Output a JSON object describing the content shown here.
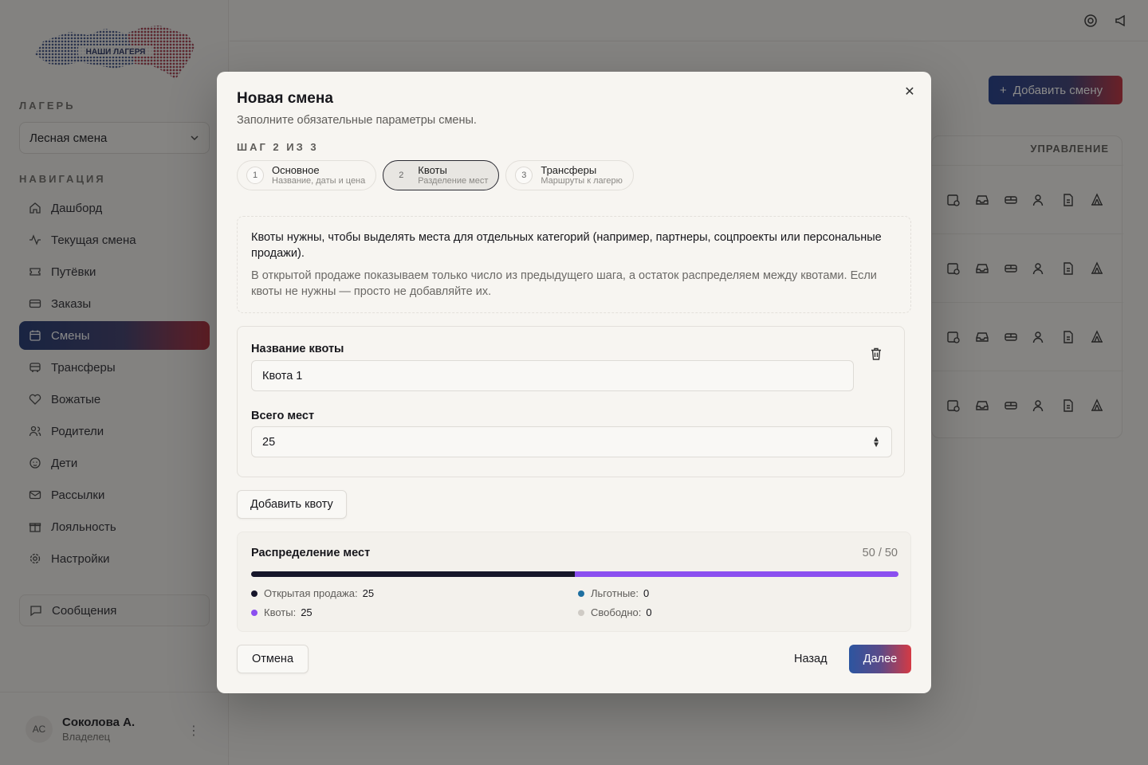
{
  "sidebar": {
    "logo_text": "НАШИ ЛАГЕРЯ",
    "camp_section_label": "ЛАГЕРЬ",
    "camp_selected": "Лесная смена",
    "nav_section_label": "НАВИГАЦИЯ",
    "nav_items": [
      {
        "label": "Дашборд",
        "icon": "home-icon"
      },
      {
        "label": "Текущая смена",
        "icon": "activity-icon"
      },
      {
        "label": "Путёвки",
        "icon": "ticket-icon"
      },
      {
        "label": "Заказы",
        "icon": "credit-card-icon"
      },
      {
        "label": "Смены",
        "icon": "calendar-icon",
        "active": true
      },
      {
        "label": "Трансферы",
        "icon": "bus-icon"
      },
      {
        "label": "Вожатые",
        "icon": "heart-handshake-icon"
      },
      {
        "label": "Родители",
        "icon": "users-icon"
      },
      {
        "label": "Дети",
        "icon": "baby-icon"
      },
      {
        "label": "Рассылки",
        "icon": "mail-icon"
      },
      {
        "label": "Лояльность",
        "icon": "gift-icon"
      },
      {
        "label": "Настройки",
        "icon": "gear-icon"
      }
    ],
    "messages_label": "Сообщения",
    "user": {
      "initials": "АС",
      "name": "Соколова А.",
      "role": "Владелец"
    }
  },
  "header": {
    "add_shift_label": "Добавить смену",
    "table_manage_header": "УПРАВЛЕНИЕ"
  },
  "modal": {
    "title": "Новая смена",
    "subtitle": "Заполните обязательные параметры смены.",
    "step_label": "ШАГ 2 ИЗ 3",
    "steps": [
      {
        "num": "1",
        "title": "Основное",
        "desc": "Название, даты и цена"
      },
      {
        "num": "2",
        "title": "Квоты",
        "desc": "Разделение мест"
      },
      {
        "num": "3",
        "title": "Трансферы",
        "desc": "Маршруты к лагерю"
      }
    ],
    "info_main": "Квоты нужны, чтобы выделять места для отдельных категорий (например, партнеры, соцпроекты или персональные продажи).",
    "info_secondary": "В открытой продаже показываем только число из предыдущего шага, а остаток распределяем между квотами. Если квоты не нужны — просто не добавляйте их.",
    "quota": {
      "name_label": "Название квоты",
      "name_value": "Квота 1",
      "seats_label": "Всего мест",
      "seats_value": "25"
    },
    "add_quota_label": "Добавить квоту",
    "distribution": {
      "title": "Распределение мест",
      "count": "50 / 50",
      "total": 50,
      "segments": [
        {
          "label": "Открытая продажа:",
          "value": 25,
          "color": "#16162a"
        },
        {
          "label": "Льготные:",
          "value": 0,
          "color": "#1e6fa0"
        },
        {
          "label": "Квоты:",
          "value": 25,
          "color": "#8b4ff0"
        },
        {
          "label": "Свободно:",
          "value": 0,
          "color": "#cfcbc5"
        }
      ]
    },
    "cancel_label": "Отмена",
    "back_label": "Назад",
    "next_label": "Далее",
    "close_symbol": "✕"
  }
}
